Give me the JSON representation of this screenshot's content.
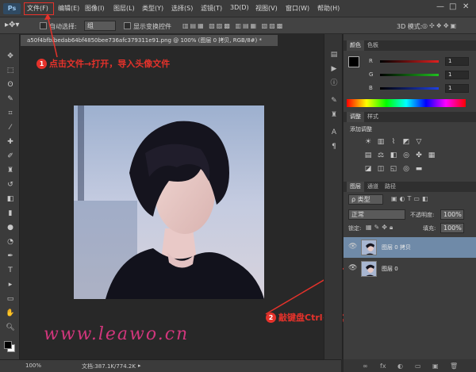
{
  "menubar": {
    "logo": "Ps",
    "items": [
      "文件(F)",
      "编辑(E)",
      "图像(I)",
      "图层(L)",
      "类型(Y)",
      "选择(S)",
      "滤镜(T)",
      "3D(D)",
      "视图(V)",
      "窗口(W)",
      "帮助(H)"
    ],
    "window_controls": [
      "—",
      "□",
      "✕"
    ]
  },
  "options": {
    "auto_select_label": "自动选择:",
    "auto_select_value": "组",
    "show_transform_label": "显示变换控件",
    "mode_3d_label": "3D 模式:"
  },
  "document": {
    "tab_title": "a50f4bfbfbedab64bf4850bee736afc379311e91.png @ 100% (图层 0 拷贝, RGB/8#) *",
    "zoom": "100%",
    "doc_info": "文档:387.1K/774.2K"
  },
  "annotations": {
    "step1_num": "1",
    "step1_text": "点击文件→打开，导入头像文件",
    "step2_num": "2",
    "step2_text": "敲键盘Ctrl+J，复制一个图层",
    "watermark": "www.leawo.cn"
  },
  "color_panel": {
    "tabs": [
      "颜色",
      "色板"
    ],
    "channels": [
      {
        "label": "R",
        "value": "1",
        "color": "#e02020"
      },
      {
        "label": "G",
        "value": "1",
        "color": "#20c020"
      },
      {
        "label": "B",
        "value": "1",
        "color": "#2040e0"
      }
    ]
  },
  "adjust_panel": {
    "tabs": [
      "调整",
      "样式"
    ],
    "title": "添加调整"
  },
  "layers_panel": {
    "tabs": [
      "图层",
      "通道",
      "路径"
    ],
    "filter_label": "ρ 类型",
    "blend_mode": "正常",
    "opacity_label": "不透明度:",
    "opacity_value": "100%",
    "lock_label": "锁定:",
    "fill_label": "填充:",
    "fill_value": "100%",
    "layers": [
      {
        "name": "图层 0 拷贝",
        "selected": true
      },
      {
        "name": "图层 0",
        "selected": false
      }
    ],
    "footer_icons": [
      "∞",
      "fx",
      "◐",
      "▭",
      "▣",
      "🗑"
    ]
  },
  "colors": {
    "accent": "#e5322b",
    "watermark": "#d1367c",
    "selected_layer": "#6f8aa8"
  }
}
